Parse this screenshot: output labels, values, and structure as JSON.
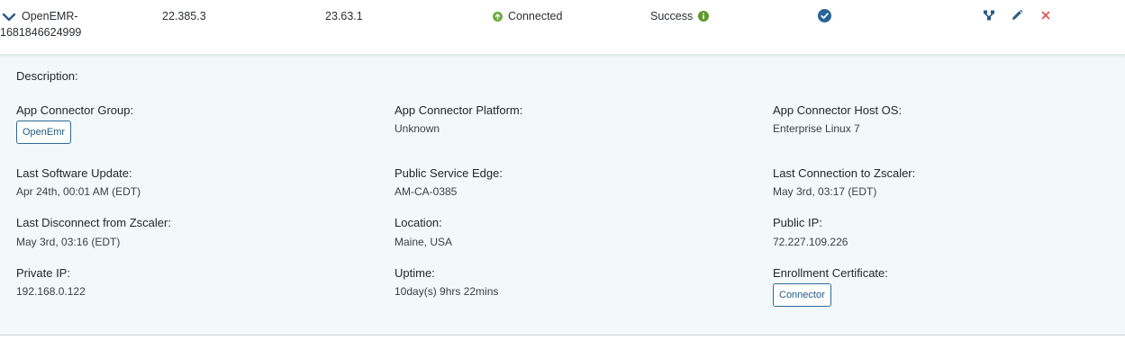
{
  "row": {
    "name_line1": "OpenEMR-",
    "name_line2": "1681846624999",
    "version_current": "22.385.3",
    "version_expected": "23.63.1",
    "status": "Connected",
    "enrollment": "Success"
  },
  "details": {
    "description_label": "Description:",
    "group_label": "App Connector Group:",
    "group_value": "OpenEmr",
    "platform_label": "App Connector Platform:",
    "platform_value": "Unknown",
    "host_os_label": "App Connector Host OS:",
    "host_os_value": "Enterprise Linux 7",
    "last_update_label": "Last Software Update:",
    "last_update_value": "Apr 24th, 00:01 AM (EDT)",
    "service_edge_label": "Public Service Edge:",
    "service_edge_value": "AM-CA-0385",
    "last_conn_label": "Last Connection to Zscaler:",
    "last_conn_value": "May 3rd, 03:17 (EDT)",
    "last_disc_label": "Last Disconnect from Zscaler:",
    "last_disc_value": "May 3rd, 03:16 (EDT)",
    "location_label": "Location:",
    "location_value": "Maine, USA",
    "public_ip_label": "Public IP:",
    "public_ip_value": "72.227.109.226",
    "private_ip_label": "Private IP:",
    "private_ip_value": "192.168.0.122",
    "uptime_label": "Uptime:",
    "uptime_value": "10day(s) 9hrs 22mins",
    "cert_label": "Enrollment Certificate:",
    "cert_value": "Connector"
  },
  "colors": {
    "connected": "#6bab3c",
    "success": "#5a9a2a",
    "accent": "#2a6496",
    "delete": "#d9534f"
  },
  "icons": [
    "chevron-down-icon",
    "arrow-up-circle-icon",
    "info-icon",
    "check-circle-icon",
    "connector-tree-icon",
    "pencil-icon",
    "close-icon"
  ]
}
